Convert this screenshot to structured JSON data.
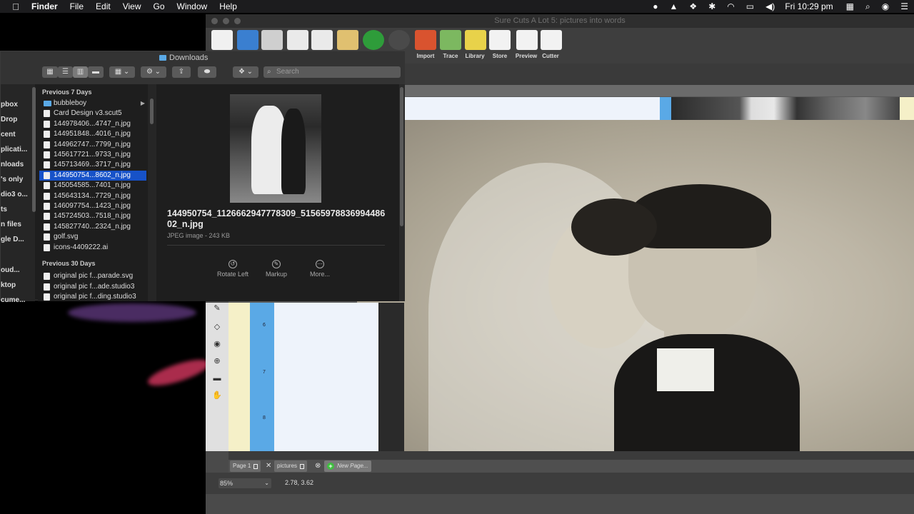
{
  "menubar": {
    "apple": "",
    "items": [
      "Finder",
      "File",
      "Edit",
      "View",
      "Go",
      "Window",
      "Help"
    ],
    "clock": "Fri 10:29 pm"
  },
  "scal": {
    "title": "Sure Cuts A Lot 5: pictures into words",
    "toolbar_labels": [
      "Import",
      "Trace",
      "Library",
      "Store",
      "Preview",
      "Cutter"
    ],
    "ruler_left_numbers": [
      "6",
      "7",
      "8"
    ],
    "tabs": [
      {
        "label": "Page 1"
      },
      {
        "label": "pictures"
      },
      {
        "label": "New Page..."
      }
    ],
    "zoom": "85%",
    "coords": "2.78, 3.62"
  },
  "finder": {
    "title": "Downloads",
    "search_placeholder": "Search",
    "sidebar": [
      "pbox",
      "Drop",
      "cent",
      "plicati...",
      "nloads",
      "'s only",
      "dio3 o...",
      "ts",
      "n files",
      "gle D...",
      "oud...",
      "ktop",
      "cume..."
    ],
    "groups": [
      {
        "title": "Previous 7 Days",
        "files": [
          "bubbleboy",
          "Card Design v3.scut5",
          "144978406...4747_n.jpg",
          "144951848...4016_n.jpg",
          "144962747...7799_n.jpg",
          "145617721...9733_n.jpg",
          "145713469...3717_n.jpg",
          "144950754...8602_n.jpg",
          "145054585...7401_n.jpg",
          "145643134...7729_n.jpg",
          "146097754...1423_n.jpg",
          "145724503...7518_n.jpg",
          "145827740...2324_n.jpg",
          "golf.svg",
          "icons-4409222.ai"
        ]
      },
      {
        "title": "Previous 30 Days",
        "files": [
          "original pic f...parade.svg",
          "original pic f...ade.studio3",
          "original pic f...ding.studio3"
        ]
      }
    ],
    "preview": {
      "filename": "144950754_1126662947778309_5156597883699448602_n.jpg",
      "meta": "JPEG image - 243 KB",
      "actions": [
        "Rotate Left",
        "Markup",
        "More..."
      ]
    }
  }
}
